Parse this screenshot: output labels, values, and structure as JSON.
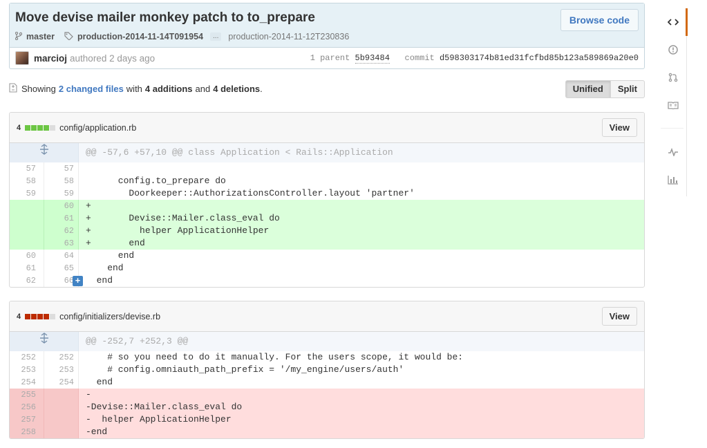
{
  "commit": {
    "title": "Move devise mailer monkey patch to to_prepare",
    "browse_label": "Browse code",
    "branch": "master",
    "tag": "production-2014-11-14T091954",
    "ellipsis": "...",
    "prev_tag": "production-2014-11-12T230836",
    "author": "marcioj",
    "authored_text": "authored 2 days ago",
    "parent_label": "1 parent",
    "parent_sha": "5b93484",
    "commit_label": "commit",
    "commit_sha": "d598303174b81ed31fcfbd85b123a589869a20e0"
  },
  "toc": {
    "showing": "Showing",
    "changed_link": "2 changed files",
    "with": "with",
    "additions": "4 additions",
    "and": "and",
    "deletions": "4 deletions",
    "period": ".",
    "unified": "Unified",
    "split": "Split"
  },
  "files": [
    {
      "count": "4",
      "name": "config/application.rb",
      "view": "View",
      "hunk": "@@ -57,6 +57,10 @@ class Application < Rails::Application",
      "lines": [
        {
          "o": "57",
          "n": "57",
          "t": ""
        },
        {
          "o": "58",
          "n": "58",
          "t": "      config.to_prepare do"
        },
        {
          "o": "59",
          "n": "59",
          "t": "        Doorkeeper::AuthorizationsController.layout 'partner'"
        },
        {
          "o": "",
          "n": "60",
          "t": "+"
        },
        {
          "o": "",
          "n": "61",
          "t": "+       Devise::Mailer.class_eval do"
        },
        {
          "o": "",
          "n": "62",
          "t": "+         helper ApplicationHelper"
        },
        {
          "o": "",
          "n": "63",
          "t": "+       end"
        },
        {
          "o": "60",
          "n": "64",
          "t": "      end"
        },
        {
          "o": "61",
          "n": "65",
          "t": "    end"
        },
        {
          "o": "62",
          "n": "66",
          "t": "  end"
        }
      ]
    },
    {
      "count": "4",
      "name": "config/initializers/devise.rb",
      "view": "View",
      "hunk": "@@ -252,7 +252,3 @@",
      "lines": [
        {
          "o": "252",
          "n": "252",
          "t": "    # so you need to do it manually. For the users scope, it would be:"
        },
        {
          "o": "253",
          "n": "253",
          "t": "    # config.omniauth_path_prefix = '/my_engine/users/auth'"
        },
        {
          "o": "254",
          "n": "254",
          "t": "  end"
        },
        {
          "o": "255",
          "n": "",
          "t": "-"
        },
        {
          "o": "256",
          "n": "",
          "t": "-Devise::Mailer.class_eval do"
        },
        {
          "o": "257",
          "n": "",
          "t": "-  helper ApplicationHelper"
        },
        {
          "o": "258",
          "n": "",
          "t": "-end"
        }
      ]
    }
  ],
  "colors": {
    "addition": "#6cc644",
    "deletion": "#bd2c00",
    "neutral": "#dddddd",
    "accent": "#d26911"
  },
  "sidebar": [
    "code-icon",
    "issue-icon",
    "pull-request-icon",
    "wiki-icon",
    "pulse-icon",
    "graph-icon"
  ]
}
